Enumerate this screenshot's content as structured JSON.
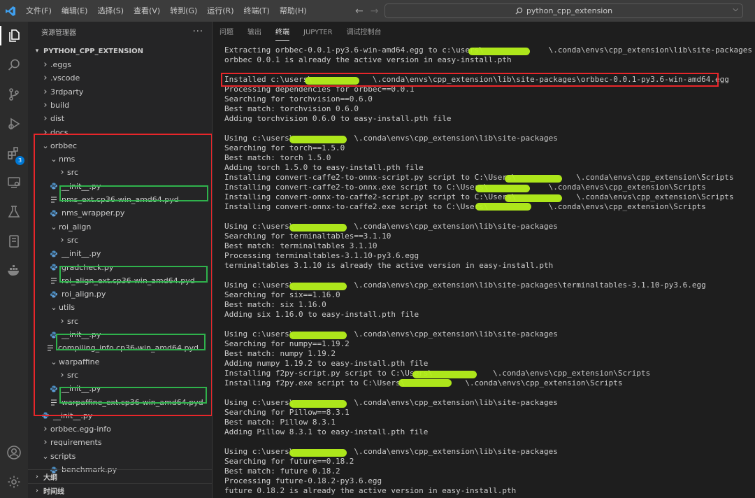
{
  "menu": [
    "文件(F)",
    "编辑(E)",
    "选择(S)",
    "查看(V)",
    "转到(G)",
    "运行(R)",
    "终端(T)",
    "帮助(H)"
  ],
  "search": {
    "text": "python_cpp_extension"
  },
  "activity": {
    "extensions_badge": "3"
  },
  "explorer": {
    "title": "资源管理器",
    "more": "···",
    "section": "PYTHON_CPP_EXTENSION",
    "tree": [
      {
        "label": ".eggs",
        "kind": "folder",
        "state": "closed"
      },
      {
        "label": ".vscode",
        "kind": "folder",
        "state": "closed"
      },
      {
        "label": "3rdparty",
        "kind": "folder",
        "state": "closed"
      },
      {
        "label": "build",
        "kind": "folder",
        "state": "closed"
      },
      {
        "label": "dist",
        "kind": "folder",
        "state": "closed"
      },
      {
        "label": "docs",
        "kind": "folder",
        "state": "closed"
      },
      {
        "label": "orbbec",
        "kind": "folder",
        "state": "open"
      },
      {
        "label": "nms",
        "kind": "folder",
        "state": "open"
      },
      {
        "label": "src",
        "kind": "folder",
        "state": "closed"
      },
      {
        "label": "__init__.py",
        "kind": "py"
      },
      {
        "label": "nms_ext.cp36-win_amd64.pyd",
        "kind": "pyd"
      },
      {
        "label": "nms_wrapper.py",
        "kind": "py"
      },
      {
        "label": "roi_align",
        "kind": "folder",
        "state": "open"
      },
      {
        "label": "src",
        "kind": "folder",
        "state": "closed"
      },
      {
        "label": "__init__.py",
        "kind": "py"
      },
      {
        "label": "gradcheck.py",
        "kind": "py"
      },
      {
        "label": "roi_align_ext.cp36-win_amd64.pyd",
        "kind": "pyd"
      },
      {
        "label": "roi_align.py",
        "kind": "py"
      },
      {
        "label": "utils",
        "kind": "folder",
        "state": "open"
      },
      {
        "label": "src",
        "kind": "folder",
        "state": "closed"
      },
      {
        "label": "__init__.py",
        "kind": "py"
      },
      {
        "label": "compiling_info.cp36-win_amd64.pyd",
        "kind": "pyd"
      },
      {
        "label": "warpaffine",
        "kind": "folder",
        "state": "open"
      },
      {
        "label": "src",
        "kind": "folder",
        "state": "closed"
      },
      {
        "label": "__init__.py",
        "kind": "py"
      },
      {
        "label": "warpaffine_ext.cp36-win_amd64.pyd",
        "kind": "pyd"
      },
      {
        "label": "__init__.py",
        "kind": "py"
      },
      {
        "label": "orbbec.egg-info",
        "kind": "folder",
        "state": "closed"
      },
      {
        "label": "requirements",
        "kind": "folder",
        "state": "closed"
      },
      {
        "label": "scripts",
        "kind": "folder",
        "state": "open"
      },
      {
        "label": "benchmark.py",
        "kind": "py"
      }
    ],
    "outline": "大纲",
    "timeline": "时间线"
  },
  "panel": {
    "tabs": [
      "问题",
      "输出",
      "终端",
      "JUPYTER",
      "调试控制台"
    ],
    "active_tab": "终端",
    "lines": [
      "Extracting orbbec-0.0.1-py3.6-win-amd64.egg to c:\\users\\              \\.conda\\envs\\cpp_extension\\lib\\site-packages",
      "orbbec 0.0.1 is already the active version in easy-install.pth",
      "",
      "Installed c:\\users\\             \\.conda\\envs\\cpp_extension\\lib\\site-packages\\orbbec-0.0.1-py3.6-win-amd64.egg",
      "Processing dependencies for orbbec==0.0.1",
      "Searching for torchvision==0.6.0",
      "Best match: torchvision 0.6.0",
      "Adding torchvision 0.6.0 to easy-install.pth file",
      "",
      "Using c:\\users\\             \\.conda\\envs\\cpp_extension\\lib\\site-packages",
      "Searching for torch==1.5.0",
      "Best match: torch 1.5.0",
      "Adding torch 1.5.0 to easy-install.pth file",
      "Installing convert-caffe2-to-onnx-script.py script to C:\\Users\\             \\.conda\\envs\\cpp_extension\\Scripts",
      "Installing convert-caffe2-to-onnx.exe script to C:\\Users\\             \\.conda\\envs\\cpp_extension\\Scripts",
      "Installing convert-onnx-to-caffe2-script.py script to C:\\Users\\             \\.conda\\envs\\cpp_extension\\Scripts",
      "Installing convert-onnx-to-caffe2.exe script to C:\\Users\\             \\.conda\\envs\\cpp_extension\\Scripts",
      "",
      "Using c:\\users\\             \\.conda\\envs\\cpp_extension\\lib\\site-packages",
      "Searching for terminaltables==3.1.10",
      "Best match: terminaltables 3.1.10",
      "Processing terminaltables-3.1.10-py3.6.egg",
      "terminaltables 3.1.10 is already the active version in easy-install.pth",
      "",
      "Using c:\\users\\             \\.conda\\envs\\cpp_extension\\lib\\site-packages\\terminaltables-3.1.10-py3.6.egg",
      "Searching for six==1.16.0",
      "Best match: six 1.16.0",
      "Adding six 1.16.0 to easy-install.pth file",
      "",
      "Using c:\\users\\             \\.conda\\envs\\cpp_extension\\lib\\site-packages",
      "Searching for numpy==1.19.2",
      "Best match: numpy 1.19.2",
      "Adding numpy 1.19.2 to easy-install.pth file",
      "Installing f2py-script.py script to C:\\Users\\             \\.conda\\envs\\cpp_extension\\Scripts",
      "Installing f2py.exe script to C:\\Users\\             \\.conda\\envs\\cpp_extension\\Scripts",
      "",
      "Using c:\\users\\             \\.conda\\envs\\cpp_extension\\lib\\site-packages",
      "Searching for Pillow==8.3.1",
      "Best match: Pillow 8.3.1",
      "Adding Pillow 8.3.1 to easy-install.pth file",
      "",
      "Using c:\\users\\             \\.conda\\envs\\cpp_extension\\lib\\site-packages",
      "Searching for future==0.18.2",
      "Best match: future 0.18.2",
      "Processing future-0.18.2-py3.6.egg",
      "future 0.18.2 is already the active version in easy-install.pth"
    ]
  }
}
